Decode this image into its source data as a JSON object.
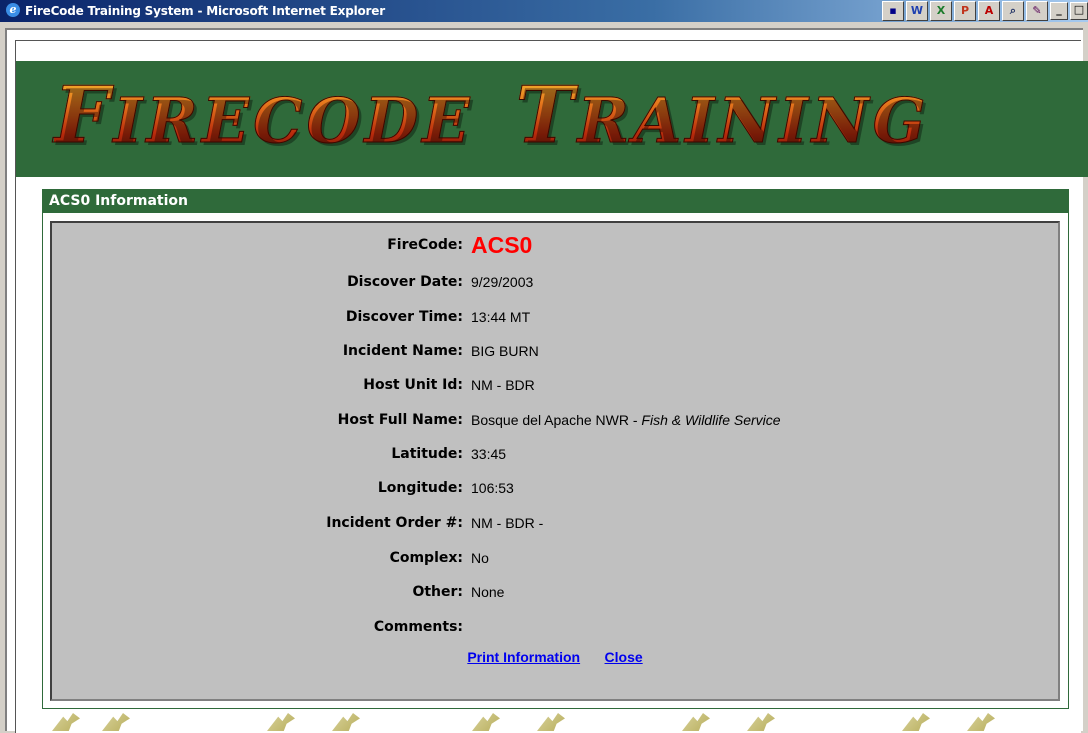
{
  "window": {
    "title": "FireCode Training System - Microsoft Internet Explorer",
    "tray_icons": [
      "app-icon",
      "word-icon",
      "excel-icon",
      "powerpoint-icon",
      "acrobat-icon",
      "search-doc-icon",
      "pen-icon"
    ],
    "controls": [
      "minimize",
      "maximize"
    ]
  },
  "banner": {
    "logo_text": "FireCode Training"
  },
  "panel": {
    "header": "ACS0 Information",
    "fields": [
      {
        "label": "FireCode:",
        "value": "ACS0"
      },
      {
        "label": "Discover Date:",
        "value": "9/29/2003"
      },
      {
        "label": "Discover Time:",
        "value": "13:44 MT"
      },
      {
        "label": "Incident Name:",
        "value": "BIG BURN"
      },
      {
        "label": "Host Unit Id:",
        "value": "NM - BDR"
      },
      {
        "label": "Host Full Name:",
        "value": "Bosque del Apache NWR - ",
        "value_italic": "Fish & Wildlife Service"
      },
      {
        "label": "Latitude:",
        "value": "33:45"
      },
      {
        "label": "Longitude:",
        "value": "106:53"
      },
      {
        "label": "Incident Order #:",
        "value": "NM - BDR -"
      },
      {
        "label": "Complex:",
        "value": "No"
      },
      {
        "label": "Other:",
        "value": "None"
      },
      {
        "label": "Comments:",
        "value": ""
      }
    ],
    "links": {
      "print": "Print Information",
      "close": "Close"
    }
  },
  "colors": {
    "banner_green": "#2f6a3a",
    "firecode_red": "#ff0000",
    "link_blue": "#0000ee",
    "info_gray": "#c0c0c0"
  }
}
